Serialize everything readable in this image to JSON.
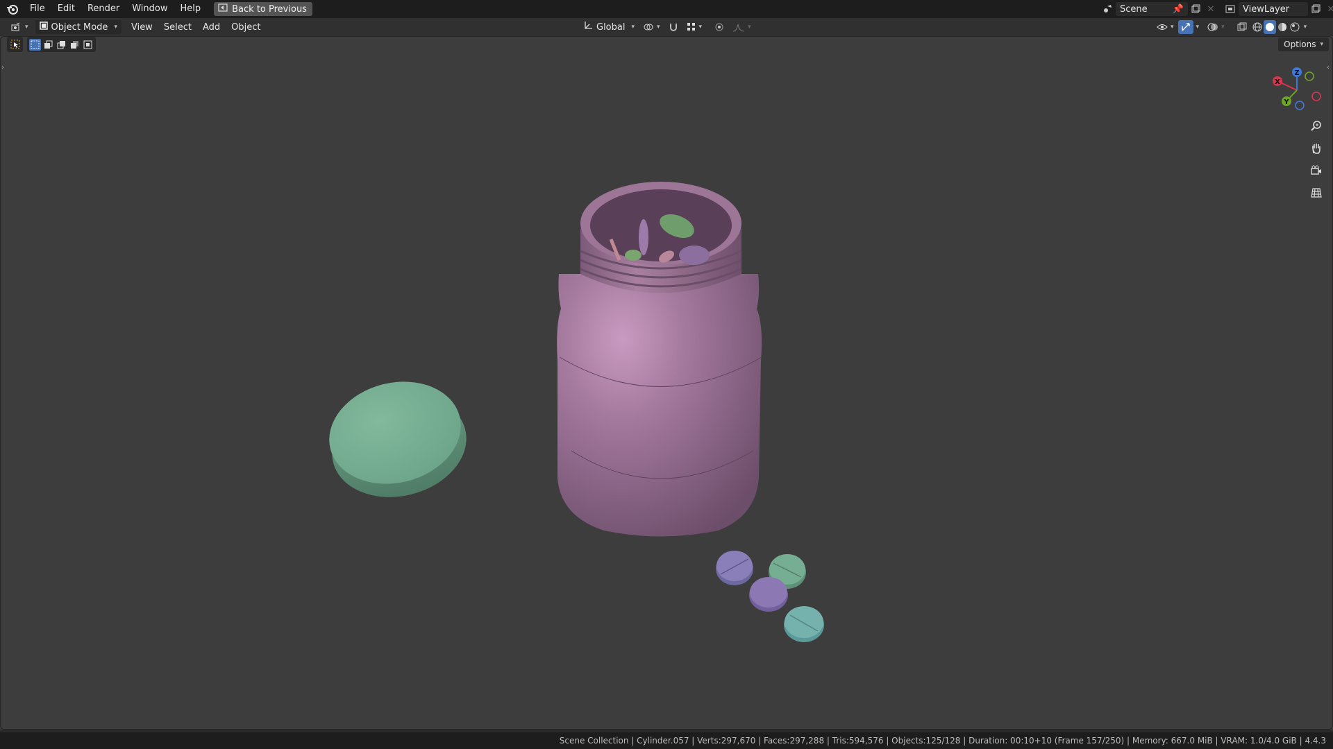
{
  "topbar": {
    "menus": [
      "File",
      "Edit",
      "Render",
      "Window",
      "Help"
    ],
    "back_label": "Back to Previous",
    "scene_name": "Scene",
    "view_layer": "ViewLayer"
  },
  "header": {
    "mode": "Object Mode",
    "menus": [
      "View",
      "Select",
      "Add",
      "Object"
    ],
    "orientation": "Global",
    "options_label": "Options"
  },
  "gizmo": {
    "x": "X",
    "y": "Y",
    "z": "Z"
  },
  "status": {
    "text": "Scene Collection | Cylinder.057 | Verts:297,670 | Faces:297,288 | Tris:594,576 | Objects:125/128 | Duration: 00:10+10 (Frame 157/250) | Memory: 667.0 MiB | VRAM: 1.0/4.0 GiB | 4.4.3"
  },
  "colors": {
    "viewport_bg": "#3d3d3d",
    "jar": "#a47a9e",
    "lid": "#76ae93",
    "pill_purple": "#8a7fb8",
    "pill_green": "#76ae93",
    "accent": "#4772b3"
  },
  "icons": [
    "blender-logo-icon",
    "back-icon",
    "editor-type-icon",
    "object-mode-icon",
    "orientation-icon",
    "pivot-icon",
    "snap-icon",
    "snap-target-icon",
    "proportional-icon",
    "falloff-icon",
    "visibility-icon",
    "gizmo-icon",
    "overlay-icon",
    "xray-icon",
    "wireframe-shading-icon",
    "solid-shading-icon",
    "material-shading-icon",
    "rendered-shading-icon",
    "zoom-icon",
    "hand-icon",
    "camera-icon",
    "grid-icon",
    "pin-icon",
    "new-scene-icon",
    "close-icon"
  ]
}
